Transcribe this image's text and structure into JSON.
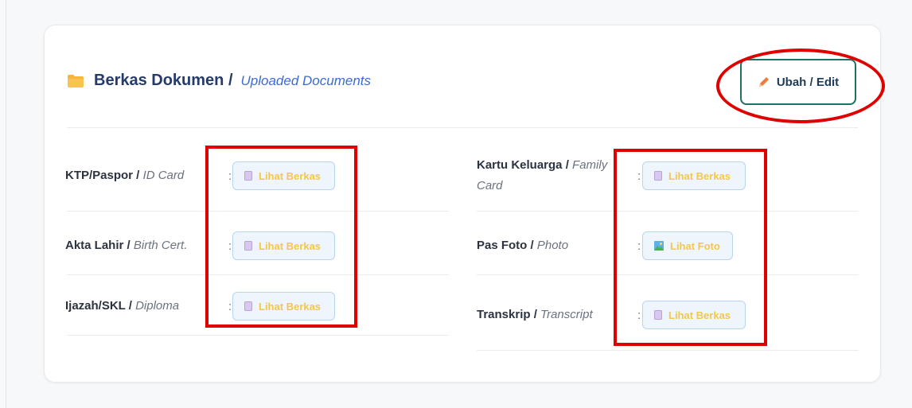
{
  "header": {
    "title": "Berkas Dokumen /",
    "subtitle": "Uploaded Documents",
    "edit_label": "Ubah / Edit"
  },
  "left_column": [
    {
      "label_bold": "KTP/Paspor /",
      "label_italic": "ID Card",
      "colon": ":",
      "button": "Lihat Berkas"
    },
    {
      "label_bold": "Akta Lahir /",
      "label_italic": "Birth Cert.",
      "colon": ":",
      "button": "Lihat Berkas"
    },
    {
      "label_bold": "Ijazah/SKL /",
      "label_italic": "Diploma",
      "colon": ":",
      "button": "Lihat Berkas"
    }
  ],
  "right_column": [
    {
      "label_bold": "Kartu Keluarga /",
      "label_italic": "Family",
      "label_italic_2": "Card",
      "colon": ":",
      "button": "Lihat Berkas"
    },
    {
      "label_bold": "Pas Foto /",
      "label_italic": "Photo",
      "colon": ":",
      "button": "Lihat Foto"
    },
    {
      "label_bold": "Transkrip /",
      "label_italic": "Transcript",
      "colon": ":",
      "button": "Lihat Berkas"
    }
  ],
  "colors": {
    "accent_red": "#e00000",
    "title_blue": "#243b6b",
    "subtitle_blue": "#3a6ad6",
    "button_text": "#f2c84b",
    "edit_border": "#1f6f66"
  },
  "icons": {
    "folder": "folder-icon",
    "pencil": "pencil-icon",
    "file": "file-icon",
    "image": "image-icon"
  }
}
